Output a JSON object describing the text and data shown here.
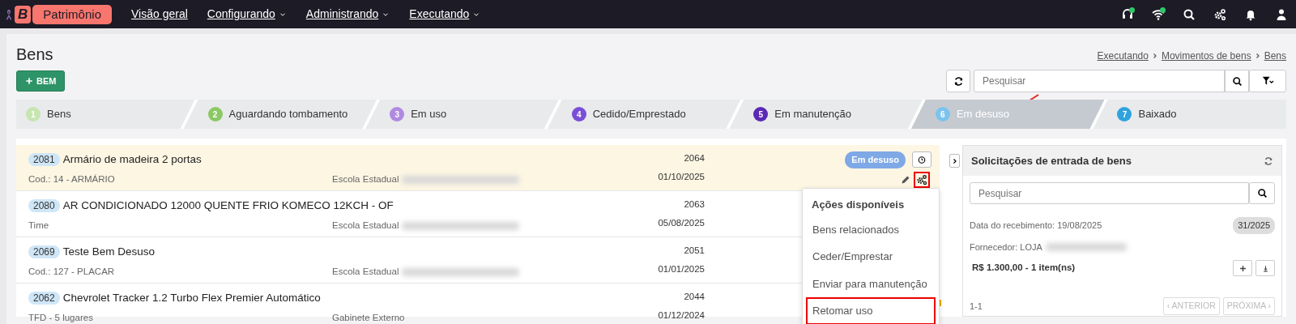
{
  "brand": {
    "letter": "B",
    "name": "Patrimônio"
  },
  "nav": [
    {
      "label": "Visão geral",
      "dropdown": false
    },
    {
      "label": "Configurando",
      "dropdown": true
    },
    {
      "label": "Administrando",
      "dropdown": true
    },
    {
      "label": "Executando",
      "dropdown": true
    }
  ],
  "nav_icons": [
    {
      "kind": "headset",
      "status_dot": true
    },
    {
      "kind": "wifi",
      "status_dot": true
    },
    {
      "kind": "search",
      "status_dot": false
    },
    {
      "kind": "gears",
      "status_dot": false
    },
    {
      "kind": "bell",
      "status_dot": false
    },
    {
      "kind": "user",
      "status_dot": false
    }
  ],
  "page": {
    "title": "Bens",
    "add_button": "BEM",
    "breadcrumb": [
      "Executando",
      "Movimentos de bens",
      "Bens"
    ]
  },
  "search": {
    "placeholder": "Pesquisar"
  },
  "steps": [
    {
      "number": "1",
      "label": "Bens",
      "color": "#c6e5b1",
      "selected": false,
      "annotated": false
    },
    {
      "number": "2",
      "label": "Aguardando tombamento",
      "color": "#8cc866",
      "selected": false,
      "annotated": false
    },
    {
      "number": "3",
      "label": "Em uso",
      "color": "#b08ae0",
      "selected": false,
      "annotated": false
    },
    {
      "number": "4",
      "label": "Cedido/Emprestado",
      "color": "#7a4ed6",
      "selected": false,
      "annotated": false
    },
    {
      "number": "5",
      "label": "Em manutenção",
      "color": "#5a2ab4",
      "selected": false,
      "annotated": false
    },
    {
      "number": "6",
      "label": "Em desuso",
      "color": "#7cc3ee",
      "selected": true,
      "annotated": true
    },
    {
      "number": "7",
      "label": "Baixado",
      "color": "#2ea3de",
      "selected": false,
      "annotated": false
    }
  ],
  "items": [
    {
      "code": "2081",
      "title": "Armário de madeira 2 portas",
      "subtitle": "Cod.: 14 - ARMÁRIO",
      "location": "Escola Estadual",
      "location_redacted": true,
      "number": "2064",
      "date": "01/10/2025",
      "status": "Em desuso",
      "highlighted": true,
      "flagged": false
    },
    {
      "code": "2080",
      "title": "AR CONDICIONADO 12000 QUENTE FRIO KOMECO 12KCH - OF",
      "subtitle": "Time",
      "location": "Escola Estadual",
      "location_redacted": true,
      "number": "2063",
      "date": "05/08/2025",
      "highlighted": false,
      "flagged": false
    },
    {
      "code": "2069",
      "title": "Teste Bem Desuso",
      "subtitle": "Cod.: 127 - PLACAR",
      "location": "Escola Estadual",
      "location_redacted": true,
      "number": "2051",
      "date": "01/01/2025",
      "highlighted": false,
      "flagged": false
    },
    {
      "code": "2062",
      "title": "Chevrolet Tracker 1.2 Turbo Flex Premier Automático",
      "subtitle": "TFD - 5 lugares",
      "location": "Gabinete Externo",
      "location_redacted": false,
      "number": "2044",
      "date": "01/12/2024",
      "highlighted": false,
      "flagged": true
    }
  ],
  "actions_menu": {
    "title": "Ações disponíveis",
    "gear_highlighted": true,
    "items": [
      {
        "label": "Bens relacionados",
        "highlighted": false
      },
      {
        "label": "Ceder/Emprestar",
        "highlighted": false
      },
      {
        "label": "Enviar para manutenção",
        "highlighted": false
      },
      {
        "label": "Retomar uso",
        "highlighted": true
      }
    ]
  },
  "sidebar": {
    "title": "Solicitações de entrada de bens",
    "search_placeholder": "Pesquisar",
    "entries": [
      {
        "date": "Data do recebimento: 19/08/2025",
        "number": "31/2025",
        "supplier": "Fornecedor: LOJA",
        "supplier_redacted": true,
        "total": "R$ 1.300,00 - 1 item(ns)"
      }
    ],
    "range": "1-1",
    "prev": {
      "label": "‹ ANTERIOR",
      "disabled": true
    },
    "next": {
      "label": "PRÓXIMA ›",
      "disabled": true
    }
  }
}
